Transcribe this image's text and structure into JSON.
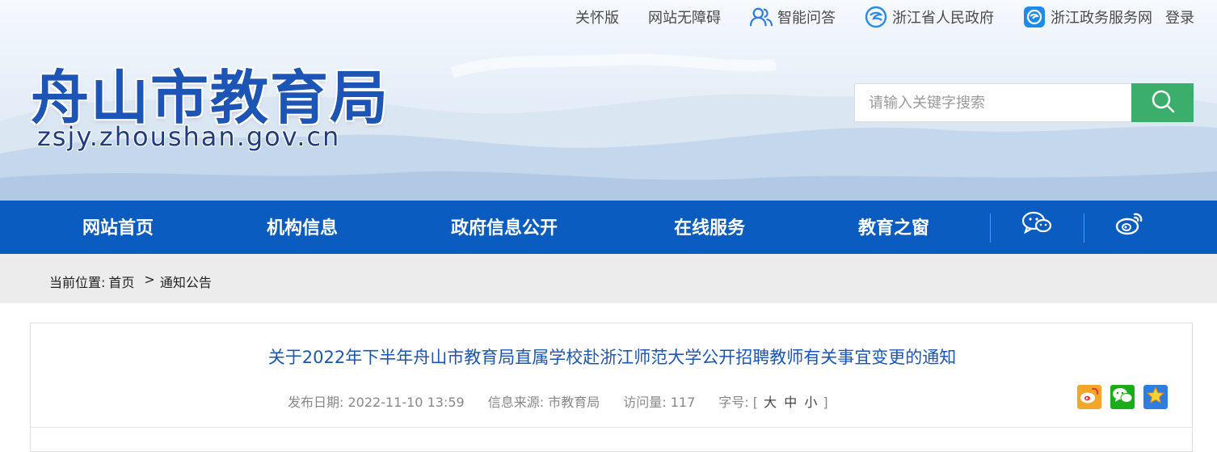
{
  "top_links": {
    "care": "关怀版",
    "accessible": "网站无障碍",
    "qa": "智能问答",
    "province": "浙江省人民政府",
    "service": "浙江政务服务网",
    "login": "登录"
  },
  "icons": {
    "qa": "users-icon",
    "province": "zhejiang-gov-icon",
    "service": "zhejiang-service-icon",
    "search": "search-icon",
    "wechat": "wechat-icon",
    "weibo": "weibo-icon",
    "favorite": "star-icon"
  },
  "logo": {
    "title": "舟山市教育局",
    "url": "zsjy.zhoushan.gov.cn"
  },
  "search": {
    "placeholder": "请输入关键字搜索"
  },
  "nav": {
    "items": [
      "网站首页",
      "机构信息",
      "政府信息公开",
      "在线服务",
      "教育之窗"
    ]
  },
  "breadcrumb": {
    "label": "当前位置:",
    "home": "首页",
    "separator": ">",
    "current": "通知公告"
  },
  "article": {
    "title": "关于2022年下半年舟山市教育局直属学校赴浙江师范大学公开招聘教师有关事宜变更的通知",
    "publish_label": "发布日期:",
    "publish_date": "2022-11-10 13:59",
    "source_label": "信息来源:",
    "source": "市教育局",
    "visits_label": "访问量:",
    "visits": "117",
    "fontsize_label": "字号:",
    "bracket_open": "[",
    "size_large": "大",
    "size_medium": "中",
    "size_small": "小",
    "bracket_close": "]"
  },
  "colors": {
    "nav_bg": "#0b5cc1",
    "search_button": "#3aae6a",
    "title_blue": "#1d55b6"
  }
}
